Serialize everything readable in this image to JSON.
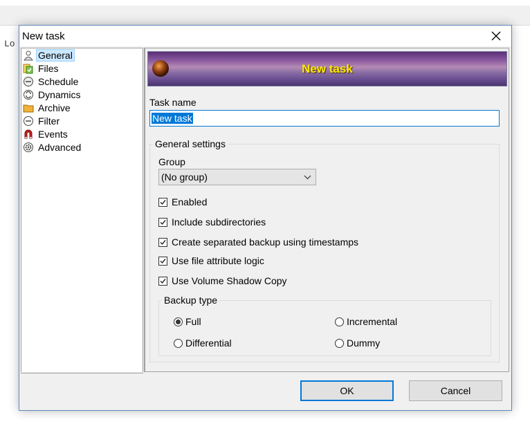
{
  "background": {
    "log_text": "Lo"
  },
  "dialog": {
    "title": "New task",
    "banner_title": "New task",
    "sidebar": {
      "items": [
        {
          "label": "General",
          "icon": "person-icon",
          "selected": true
        },
        {
          "label": "Files",
          "icon": "files-icon",
          "selected": false
        },
        {
          "label": "Schedule",
          "icon": "schedule-icon",
          "selected": false
        },
        {
          "label": "Dynamics",
          "icon": "dynamics-icon",
          "selected": false
        },
        {
          "label": "Archive",
          "icon": "archive-icon",
          "selected": false
        },
        {
          "label": "Filter",
          "icon": "filter-icon",
          "selected": false
        },
        {
          "label": "Events",
          "icon": "magnet-icon",
          "selected": false
        },
        {
          "label": "Advanced",
          "icon": "gear-icon",
          "selected": false
        }
      ]
    },
    "task_name": {
      "label": "Task name",
      "value": "New task"
    },
    "general_settings": {
      "title": "General settings",
      "group_label": "Group",
      "group_value": "(No group)",
      "checkboxes": [
        {
          "label": "Enabled",
          "checked": true
        },
        {
          "label": "Include subdirectories",
          "checked": true
        },
        {
          "label": "Create separated backup using timestamps",
          "checked": true
        },
        {
          "label": "Use file attribute logic",
          "checked": true
        },
        {
          "label": "Use Volume Shadow Copy",
          "checked": true
        }
      ],
      "backup_type": {
        "title": "Backup type",
        "options": [
          {
            "label": "Full",
            "selected": true
          },
          {
            "label": "Incremental",
            "selected": false
          },
          {
            "label": "Differential",
            "selected": false
          },
          {
            "label": "Dummy",
            "selected": false
          }
        ]
      }
    },
    "buttons": {
      "ok": "OK",
      "cancel": "Cancel"
    },
    "colors": {
      "accent": "#0078d7",
      "selection_bg": "#cce8ff",
      "banner_text": "#ffea00",
      "banner_purple": "#6a4f92"
    }
  }
}
